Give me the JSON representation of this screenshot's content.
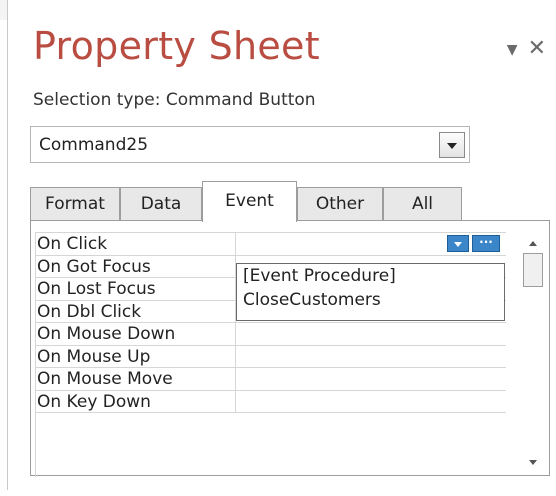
{
  "panel": {
    "title": "Property Sheet",
    "selection_type": "Selection type:  Command Button"
  },
  "object_selector": {
    "value": "Command25"
  },
  "tabs": [
    {
      "label": "Format"
    },
    {
      "label": "Data"
    },
    {
      "label": "Event",
      "active": true
    },
    {
      "label": "Other"
    },
    {
      "label": "All"
    }
  ],
  "properties": [
    {
      "label": "On Click"
    },
    {
      "label": "On Got Focus"
    },
    {
      "label": "On Lost Focus"
    },
    {
      "label": "On Dbl Click"
    },
    {
      "label": "On Mouse Down"
    },
    {
      "label": "On Mouse Up"
    },
    {
      "label": "On Mouse Move"
    },
    {
      "label": "On Key Down"
    }
  ],
  "dropdown": {
    "options": [
      "[Event Procedure]",
      "CloseCustomers"
    ]
  },
  "icons": {
    "menu": "chevron-down-icon",
    "close": "close-icon",
    "build": "ellipsis-icon"
  },
  "colors": {
    "title": "#b94d42",
    "accent_button": "#3b86c8"
  }
}
